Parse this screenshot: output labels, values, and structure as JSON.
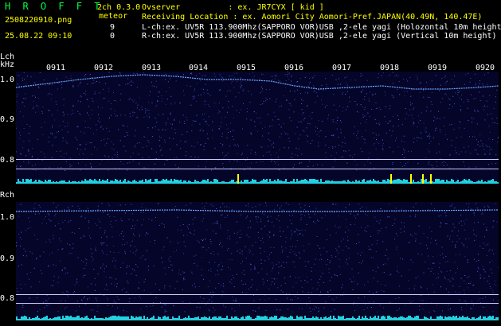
{
  "header": {
    "logo": "H R O F F T",
    "mode": "2ch 0.3.0",
    "meteor_label": "meteor",
    "filename": "2508220910.png",
    "datetime": "25.08.22 09:10",
    "lch_count": "9",
    "rch_count": "0",
    "observer": "Ovserver          : ex. JR7CYX [ kid ]",
    "location": "Receiving Location : ex. Aomori City Aomori-Pref.JAPAN(40.49N, 140.47E)",
    "lch_info": "L-ch:ex. UV5R 113.900Mhz(SAPPORO VOR)USB ,2-ele yagi (Holozontal 10m height)",
    "rch_info": "R-ch:ex. UV5R 113.900Mhz(SAPPORO VOR)USB ,2-ele yagi (Vertical 10m height)"
  },
  "lch": {
    "label": "Lch",
    "unit": "kHz",
    "yticks": [
      "1.0",
      "0.9",
      "0.8"
    ]
  },
  "rch": {
    "label": "Rch",
    "yticks": [
      "1.0",
      "0.9",
      "0.8"
    ]
  },
  "time_ticks": [
    "0911",
    "0912",
    "0913",
    "0914",
    "0915",
    "0916",
    "0917",
    "0918",
    "0919",
    "0920"
  ],
  "colors": {
    "background": "#000000",
    "logo": "#00ff44",
    "header_text": "#ffff00",
    "trace": "#6aa8ff",
    "level_bar": "#22d0e0",
    "meteor_spike": "#ffff00"
  }
}
